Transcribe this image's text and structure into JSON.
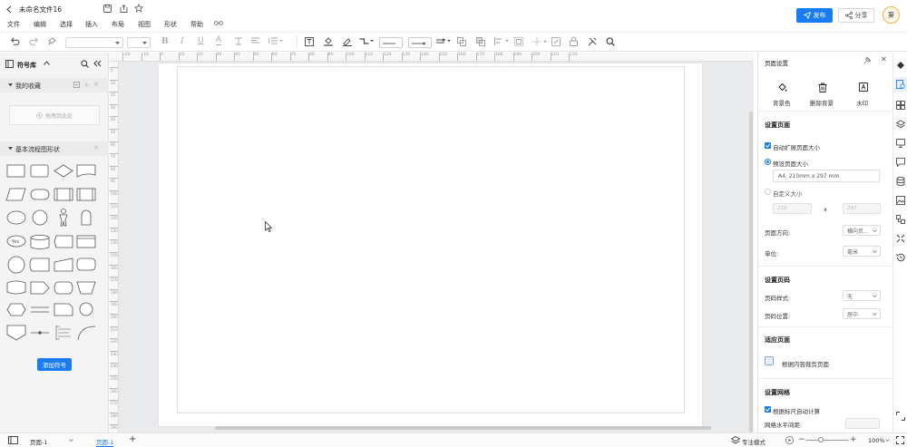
{
  "title": "未命名文件16",
  "menu": [
    "文件",
    "编辑",
    "选择",
    "插入",
    "布局",
    "视图",
    "形状",
    "帮助"
  ],
  "header": {
    "publish": "发布",
    "share": "分享",
    "avatar": "葵"
  },
  "colors": {
    "accent": "#1a7cf5",
    "panel_bg": "#f4f4f5",
    "canvas_bg": "#e9eaec"
  },
  "left_panel": {
    "title": "符号库",
    "favorites": {
      "title": "我的收藏",
      "drop_hint": "拖拽到此处"
    },
    "basic": {
      "title": "基本流程图形状"
    },
    "add_button": "添加符号"
  },
  "ruler": {
    "top": [
      "-20",
      "-10",
      "0",
      "10",
      "20",
      "30",
      "40",
      "50",
      "60",
      "70",
      "80",
      "90",
      "100",
      "110",
      "120",
      "130",
      "140",
      "150",
      "160",
      "170",
      "180",
      "190",
      "200",
      "210",
      "220"
    ],
    "left": [
      "0",
      "10",
      "20",
      "30",
      "40",
      "50",
      "60",
      "70",
      "80",
      "90",
      "100",
      "110",
      "120",
      "130",
      "140",
      "150",
      "160",
      "170",
      "180",
      "190",
      "200",
      "210",
      "220",
      "230",
      "240",
      "250",
      "260",
      "270",
      "280",
      "290"
    ]
  },
  "right_panel": {
    "title": "页面设置",
    "tools": [
      "背景色",
      "删除背景",
      "水印"
    ],
    "page": {
      "title": "设置页面",
      "auto_expand": "自动扩展页面大小",
      "preset": "预设页面大小",
      "preset_value": "A4, 210mm x 297 mm",
      "custom": "自定义大小",
      "width_value": "210",
      "height_value": "297",
      "times": "x",
      "orientation_label": "页面方向:",
      "orientation_value": "横向页...",
      "unit_label": "单位:",
      "unit_value": "毫米"
    },
    "page_number": {
      "title": "设置页码",
      "style_label": "页码样式:",
      "style_value": "无",
      "position_label": "页码位置:",
      "position_value": "居中"
    },
    "fit": {
      "title": "适应页面",
      "button": "根据内容裁剪页面"
    },
    "grid": {
      "title": "设置网格",
      "auto_calc": "根据标尺自动计算",
      "h_spacing_label": "网格水平间距:"
    }
  },
  "status": {
    "page_tab_1": "页面-1",
    "page_tab_active": "页面-1",
    "focus_mode": "专注模式",
    "zoom": "100%"
  }
}
